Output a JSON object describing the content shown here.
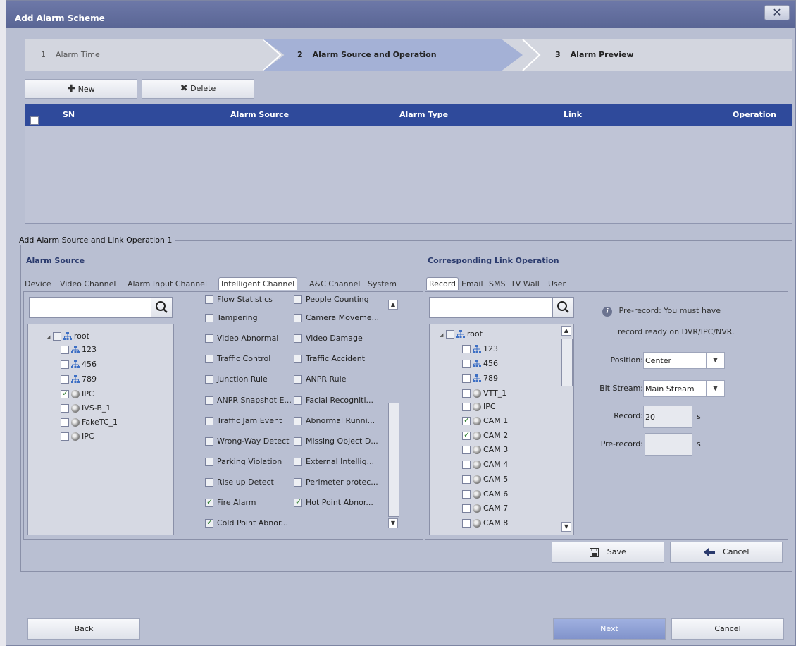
{
  "window": {
    "title": "Add Alarm Scheme",
    "close_glyph": "✕"
  },
  "wizard": {
    "steps": [
      {
        "num": "1",
        "label": "Alarm Time"
      },
      {
        "num": "2",
        "label": "Alarm Source and Operation"
      },
      {
        "num": "3",
        "label": "Alarm Preview"
      }
    ],
    "active_step": 2
  },
  "toolbar": {
    "new_label": "New",
    "delete_label": "Delete"
  },
  "grid": {
    "columns": [
      "SN",
      "Alarm Source",
      "Alarm Type",
      "Link",
      "Operation"
    ]
  },
  "section": {
    "title": "Add Alarm Source and Link Operation 1",
    "alarm_source_label": "Alarm Source",
    "link_label": "Corresponding Link Operation"
  },
  "source_tabs": [
    "Device",
    "Video Channel",
    "Alarm Input Channel",
    "Intelligent Channel",
    "A&C Channel",
    "System"
  ],
  "source_tab_active": "Intelligent Channel",
  "source_tree": {
    "root": "root",
    "items": [
      {
        "label": "123",
        "icon": "network-icon",
        "checked": false
      },
      {
        "label": "456",
        "icon": "network-icon",
        "checked": false
      },
      {
        "label": "789",
        "icon": "network-icon",
        "checked": false
      },
      {
        "label": "IPC",
        "icon": "camera-icon",
        "checked": true
      },
      {
        "label": "IVS-B_1",
        "icon": "camera-icon",
        "checked": false
      },
      {
        "label": "FakeTC_1",
        "icon": "camera-icon",
        "checked": false
      },
      {
        "label": "IPC",
        "icon": "camera-icon",
        "checked": false
      }
    ]
  },
  "alarm_types": {
    "left": [
      {
        "label": "Flow Statistics",
        "checked": false
      },
      {
        "label": "Tampering",
        "checked": false
      },
      {
        "label": "Video Abnormal",
        "checked": false
      },
      {
        "label": "Traffic Control",
        "checked": false
      },
      {
        "label": "Junction Rule",
        "checked": false
      },
      {
        "label": "ANPR Snapshot E...",
        "checked": false
      },
      {
        "label": "Traffic Jam Event",
        "checked": false
      },
      {
        "label": "Wrong-Way Detect",
        "checked": false
      },
      {
        "label": "Parking Violation",
        "checked": false
      },
      {
        "label": "Rise up Detect",
        "checked": false
      },
      {
        "label": "Fire Alarm",
        "checked": true
      },
      {
        "label": "Cold Point Abnor...",
        "checked": true
      }
    ],
    "right": [
      {
        "label": "People Counting",
        "checked": false
      },
      {
        "label": "Camera Moveme...",
        "checked": false
      },
      {
        "label": "Video Damage",
        "checked": false
      },
      {
        "label": "Traffic Accident",
        "checked": false
      },
      {
        "label": "ANPR Rule",
        "checked": false
      },
      {
        "label": "Facial Recogniti...",
        "checked": false
      },
      {
        "label": "Abnormal Runni...",
        "checked": false
      },
      {
        "label": "Missing Object D...",
        "checked": false
      },
      {
        "label": "External Intellig...",
        "checked": false
      },
      {
        "label": "Perimeter protec...",
        "checked": false
      },
      {
        "label": "Hot Point Abnor...",
        "checked": true
      }
    ]
  },
  "link_tabs": [
    "Record",
    "Email",
    "SMS",
    "TV Wall",
    "User"
  ],
  "link_tab_active": "Record",
  "link_tree": {
    "root": "root",
    "items": [
      {
        "label": "123",
        "icon": "network-icon",
        "checked": false
      },
      {
        "label": "456",
        "icon": "network-icon",
        "checked": false
      },
      {
        "label": "789",
        "icon": "network-icon",
        "checked": false
      },
      {
        "label": "VTT_1",
        "icon": "camera-icon",
        "checked": false
      },
      {
        "label": "IPC",
        "icon": "camera-icon",
        "checked": false
      },
      {
        "label": "CAM 1",
        "icon": "camera-icon",
        "checked": true
      },
      {
        "label": "CAM 2",
        "icon": "camera-icon",
        "checked": true
      },
      {
        "label": "CAM 3",
        "icon": "camera-icon",
        "checked": false
      },
      {
        "label": "CAM 4",
        "icon": "camera-icon",
        "checked": false
      },
      {
        "label": "CAM 5",
        "icon": "camera-icon",
        "checked": false
      },
      {
        "label": "CAM 6",
        "icon": "camera-icon",
        "checked": false
      },
      {
        "label": "CAM 7",
        "icon": "camera-icon",
        "checked": false
      },
      {
        "label": "CAM 8",
        "icon": "camera-icon",
        "checked": false
      }
    ]
  },
  "record_settings": {
    "info_line1": "Pre-record: You must have",
    "info_line2": "record ready on DVR/IPC/NVR.",
    "position_label": "Position:",
    "position_value": "Center",
    "bitstream_label": "Bit Stream:",
    "bitstream_value": "Main Stream",
    "record_label": "Record:",
    "record_value": "20",
    "record_unit": "s",
    "prerecord_label": "Pre-record:",
    "prerecord_value": "",
    "prerecord_unit": "s"
  },
  "panel_buttons": {
    "save": "Save",
    "cancel": "Cancel"
  },
  "footer": {
    "back": "Back",
    "next": "Next",
    "cancel": "Cancel"
  },
  "colors": {
    "header_blue": "#2f4a9b",
    "dialog_bg": "#b9bfd2",
    "active_step": "#a4b1d6",
    "next_button": "#8c9dd3"
  }
}
